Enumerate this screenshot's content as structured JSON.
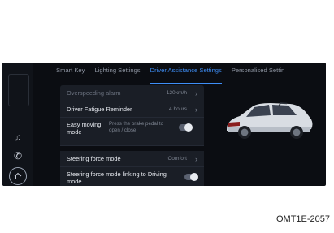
{
  "tabs": [
    {
      "label": "Smart Key",
      "active": false
    },
    {
      "label": "Lighting Settings",
      "active": false
    },
    {
      "label": "Driver Assistance Settings",
      "active": true
    },
    {
      "label": "Personalised Settin",
      "active": false
    }
  ],
  "rows": {
    "overspeed": {
      "label": "Overspeeding alarm",
      "value": "120km/h"
    },
    "fatigue": {
      "label": "Driver Fatigue Reminder",
      "value": "4 hours"
    },
    "easy_moving": {
      "label": "Easy moving mode",
      "hint": "Press the brake pedal to open / close"
    },
    "steering": {
      "label": "Steering force mode",
      "value": "Comfort"
    },
    "steering_link": {
      "label": "Steering force mode linking to Driving mode"
    }
  },
  "figure_code": "OMT1E-2057",
  "colors": {
    "accent": "#3e8ef7",
    "screen_bg": "#0b0d12",
    "panel_bg": "#1a1e26"
  },
  "icons": [
    "music-icon",
    "phone-icon",
    "home-icon",
    "chevron-right-icon",
    "toggle-switch"
  ]
}
